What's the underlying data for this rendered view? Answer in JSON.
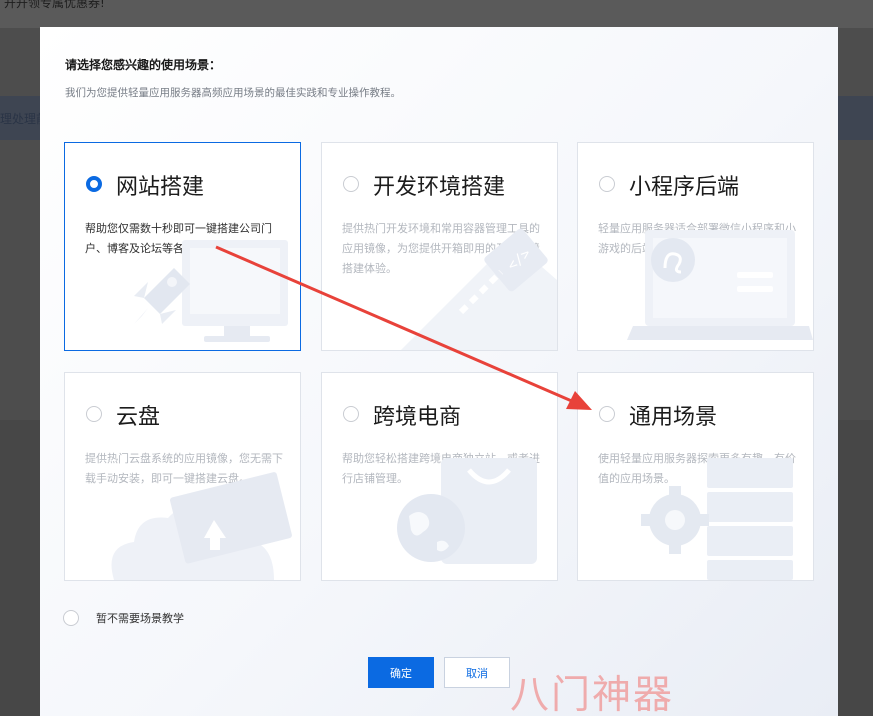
{
  "background": {
    "top_text": "开开领专属优惠券!",
    "band_text": "理处理前"
  },
  "modal": {
    "title": "请选择您感兴趣的使用场景：",
    "subtitle": "我们为您提供轻量应用服务器高频应用场景的最佳实践和专业操作教程。",
    "cards": [
      {
        "title": "网站搭建",
        "desc": "帮助您仅需数十秒即可一键搭建公司门户、博客及论坛等各类网站。",
        "selected": true,
        "icon": "rocket-monitor-illustration"
      },
      {
        "title": "开发环境搭建",
        "desc": "提供热门开发环境和常用容器管理工具的应用镜像，为您提供开箱即用的开发环境搭建体验。",
        "selected": false,
        "icon": "code-tag-illustration"
      },
      {
        "title": "小程序后端",
        "desc": "轻量应用服务器适合部署微信小程序和小游戏的后端HTTPS服务。",
        "selected": false,
        "icon": "mini-program-laptop-illustration"
      },
      {
        "title": "云盘",
        "desc": "提供热门云盘系统的应用镜像，您无需下载手动安装，即可一键搭建云盘。",
        "selected": false,
        "icon": "cloud-upload-illustration"
      },
      {
        "title": "跨境电商",
        "desc": "帮助您轻松搭建跨境电商独立站，或者进行店铺管理。",
        "selected": false,
        "icon": "globe-bag-illustration"
      },
      {
        "title": "通用场景",
        "desc": "使用轻量应用服务器探索更多有趣、有价值的应用场景。",
        "selected": false,
        "icon": "gear-server-illustration"
      }
    ],
    "skip_label": "暂不需要场景教学",
    "ok_label": "确定",
    "cancel_label": "取消"
  },
  "watermark": "八门神器",
  "colors": {
    "accent": "#0b6ae2",
    "annotation_arrow": "#e8423a"
  }
}
